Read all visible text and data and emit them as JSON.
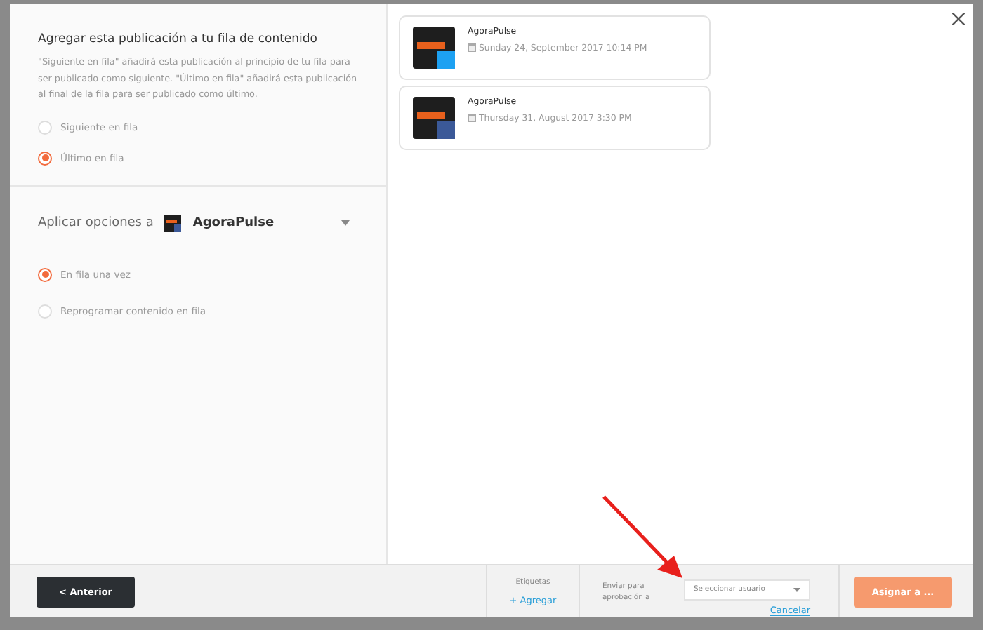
{
  "queue": {
    "title": "Agregar esta publicación a tu fila de contenido",
    "description": "\"Siguiente en fila\" añadirá esta publicación al principio de tu fila para ser publicado como siguiente. \"Último en fila\" añadirá esta publicación al final de la fila para ser publicado como último.",
    "options": [
      {
        "label": "Siguiente en fila",
        "selected": false
      },
      {
        "label": "Último en fila",
        "selected": true
      }
    ]
  },
  "apply": {
    "label": "Aplicar opciones a",
    "account": "AgoraPulse",
    "options": [
      {
        "label": "En fila una vez",
        "selected": true
      },
      {
        "label": "Reprogramar contenido en fila",
        "selected": false
      }
    ]
  },
  "posts": [
    {
      "account": "AgoraPulse",
      "date": "Sunday 24, September 2017 10:14 PM",
      "kind": "twitter"
    },
    {
      "account": "AgoraPulse",
      "date": "Thursday 31, August 2017 3:30 PM",
      "kind": "facebook"
    }
  ],
  "footer": {
    "back": "< Anterior",
    "tags_label": "Etiquetas",
    "tags_add": "+ Agregar",
    "approval_label": "Enviar para aprobación a",
    "user_placeholder": "Seleccionar usuario",
    "cancel": "Cancelar",
    "assign": "Asignar a ..."
  }
}
